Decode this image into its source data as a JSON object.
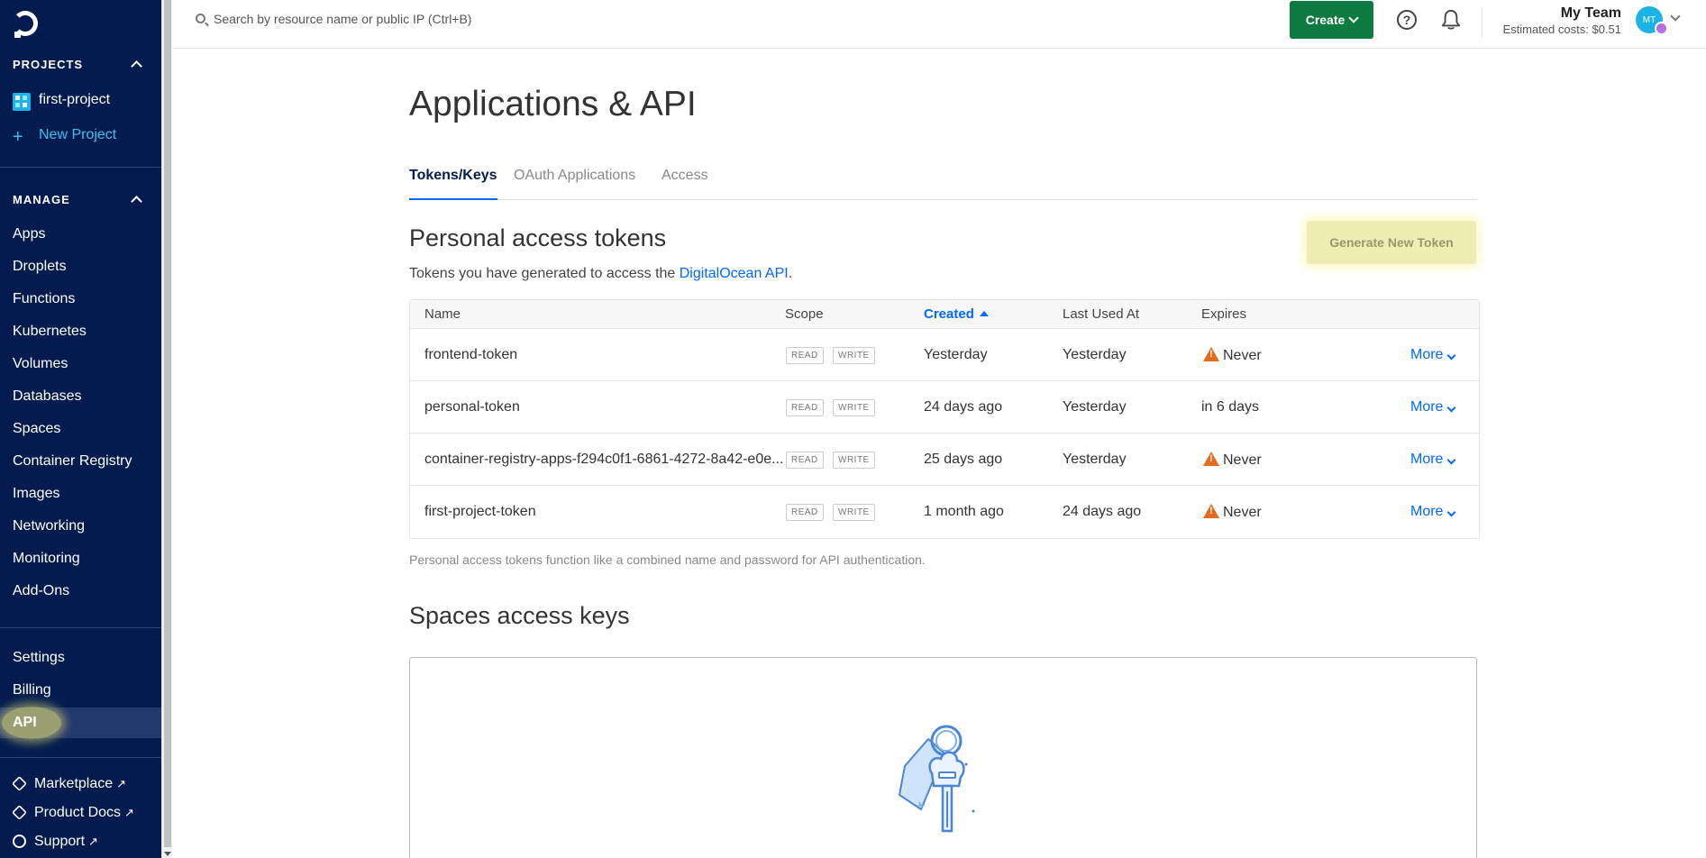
{
  "sidebar": {
    "projects_header": "PROJECTS",
    "project_name": "first-project",
    "new_project": "New Project",
    "manage_header": "MANAGE",
    "manage_items": [
      "Apps",
      "Droplets",
      "Functions",
      "Kubernetes",
      "Volumes",
      "Databases",
      "Spaces",
      "Container Registry",
      "Images",
      "Networking",
      "Monitoring",
      "Add-Ons"
    ],
    "account_items": [
      "Settings",
      "Billing",
      "API"
    ],
    "external_links": [
      "Marketplace",
      "Product Docs",
      "Support"
    ]
  },
  "topbar": {
    "search_placeholder": "Search by resource name or public IP (Ctrl+B)",
    "create_label": "Create",
    "team_name": "My Team",
    "estimated_costs": "Estimated costs: $0.51",
    "avatar_initials": "MT"
  },
  "main": {
    "title": "Applications & API",
    "tabs": [
      "Tokens/Keys",
      "OAuth Applications",
      "Access"
    ],
    "tokens_section": {
      "title": "Personal access tokens",
      "generate_button": "Generate New Token",
      "description_prefix": "Tokens you have generated to access the ",
      "description_link": "DigitalOcean API",
      "description_suffix": ".",
      "columns": [
        "Name",
        "Scope",
        "Created",
        "Last Used At",
        "Expires"
      ],
      "scope_read": "READ",
      "scope_write": "WRITE",
      "more_label": "More",
      "rows": [
        {
          "name": "frontend-token",
          "created": "Yesterday",
          "last_used": "Yesterday",
          "expires": "Never",
          "warn": true
        },
        {
          "name": "personal-token",
          "created": "24 days ago",
          "last_used": "Yesterday",
          "expires": "in 6 days",
          "warn": false
        },
        {
          "name": "container-registry-apps-f294c0f1-6861-4272-8a42-e0e...",
          "created": "25 days ago",
          "last_used": "Yesterday",
          "expires": "Never",
          "warn": true
        },
        {
          "name": "first-project-token",
          "created": "1 month ago",
          "last_used": "24 days ago",
          "expires": "Never",
          "warn": true
        }
      ],
      "footnote": "Personal access tokens function like a combined name and password for API authentication."
    },
    "spaces_section": {
      "title": "Spaces access keys"
    }
  },
  "colors": {
    "sidebar_bg": "#031b4e",
    "accent_blue": "#0069ff",
    "create_green": "#0d7a3f",
    "warning_orange": "#e66a1e"
  }
}
